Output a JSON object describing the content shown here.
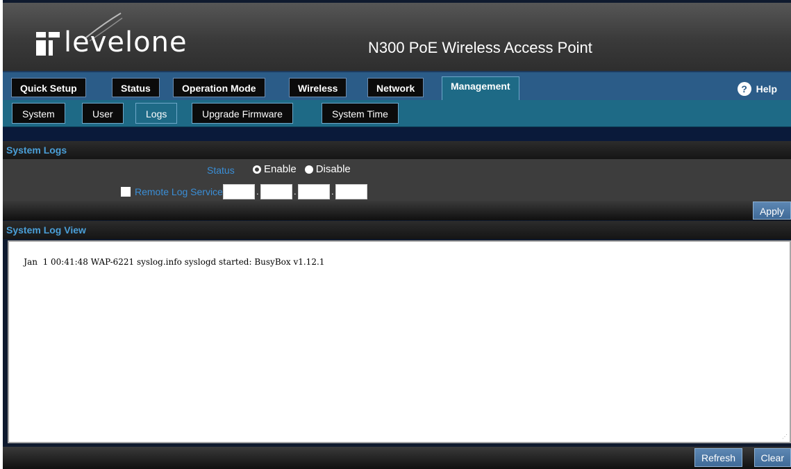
{
  "header": {
    "brand": "levelone",
    "product_title": "N300 PoE Wireless Access Point"
  },
  "topnav": {
    "tabs": [
      {
        "label": "Quick Setup"
      },
      {
        "label": "Status"
      },
      {
        "label": "Operation Mode"
      },
      {
        "label": "Wireless"
      },
      {
        "label": "Network"
      },
      {
        "label": "Management"
      }
    ],
    "active_tab": "Management",
    "help_label": "Help"
  },
  "subnav": {
    "tabs": [
      {
        "label": "System"
      },
      {
        "label": "User"
      },
      {
        "label": "Logs"
      },
      {
        "label": "Upgrade Firmware"
      },
      {
        "label": "System Time"
      }
    ],
    "active_tab": "Logs"
  },
  "system_logs": {
    "heading": "System Logs",
    "status_label": "Status",
    "enable_label": "Enable",
    "disable_label": "Disable",
    "status_value": "Enable",
    "remote_label": "Remote Log Service",
    "remote_checked": false,
    "apply_label": "Apply"
  },
  "log_view": {
    "heading": "System Log View",
    "content": "Jan  1 00:41:48 WAP-6221 syslog.info syslogd started: BusyBox v1.12.1",
    "refresh_label": "Refresh",
    "clear_label": "Clear"
  },
  "colors": {
    "accent_blue": "#3a8ed6",
    "nav_blue": "#2b5c88",
    "subnav_teal": "#1e6a86",
    "button_blue": "#4f7aa6"
  }
}
